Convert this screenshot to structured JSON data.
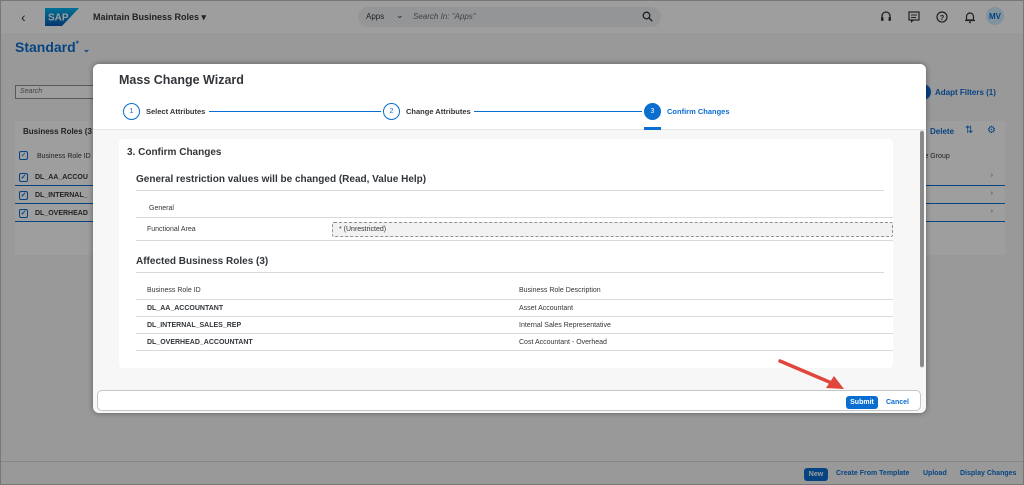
{
  "shell": {
    "back_icon": "chevron-left-icon",
    "logo_text": "SAP",
    "app_title": "Maintain Business Roles",
    "search": {
      "scope": "Apps",
      "placeholder": "Search In: \"Apps\""
    },
    "avatar": "MV",
    "icons": [
      "headset-icon",
      "feedback-icon",
      "help-icon",
      "notification-icon"
    ]
  },
  "page": {
    "variant": "Standard",
    "variant_marker": "*",
    "filter_search_placeholder": "Search",
    "adapt_filters": "Adapt Filters (1)",
    "table": {
      "title": "Business Roles (3",
      "delete": "Delete",
      "column_id": "Business Role ID",
      "column_group": "ole Group",
      "rows": [
        "DL_AA_ACCOU",
        "DL_INTERNAL_",
        "DL_OVERHEAD"
      ]
    },
    "footer": {
      "new": "New",
      "create_from_template": "Create From Template",
      "upload": "Upload",
      "display_changes": "Display Changes"
    }
  },
  "dialog": {
    "title": "Mass Change Wizard",
    "steps": [
      {
        "num": "1",
        "label": "Select Attributes"
      },
      {
        "num": "2",
        "label": "Change Attributes"
      },
      {
        "num": "3",
        "label": "Confirm Changes"
      }
    ],
    "section_title": "3. Confirm Changes",
    "restriction_title": "General restriction values will be changed (Read, Value Help)",
    "general_label": "General",
    "field_label": "Functional Area",
    "field_value": "* (Unrestricted)",
    "affected_title": "Affected Business Roles (3)",
    "columns": {
      "id": "Business Role ID",
      "description": "Business Role Description"
    },
    "roles": [
      {
        "id": "DL_AA_ACCOUNTANT",
        "description": "Asset Accountant"
      },
      {
        "id": "DL_INTERNAL_SALES_REP",
        "description": "Internal Sales Representative"
      },
      {
        "id": "DL_OVERHEAD_ACCOUNTANT",
        "description": "Cost Accountant - Overhead"
      }
    ],
    "submit": "Submit",
    "cancel": "Cancel"
  },
  "colors": {
    "accent": "#0a6ed1",
    "arrow": "#e0463c",
    "text": "#32363a"
  }
}
